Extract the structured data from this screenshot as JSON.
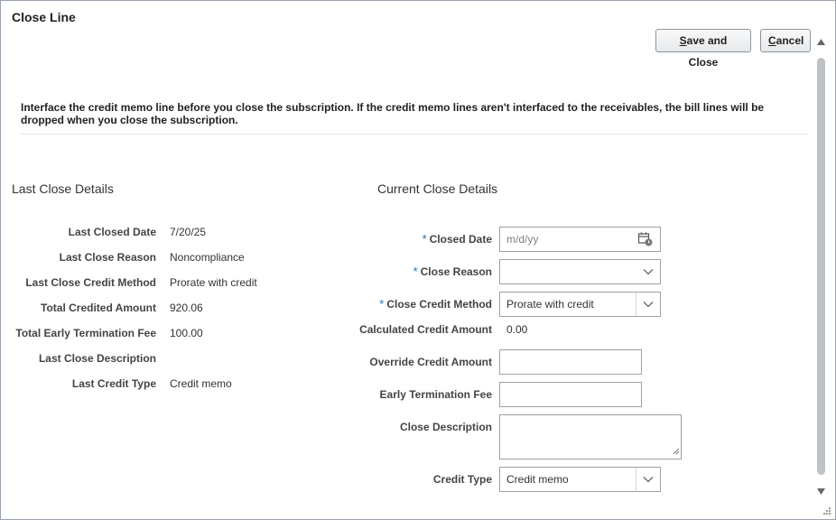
{
  "dialog": {
    "title": "Close Line",
    "save_label_pre": "",
    "save_label_u": "S",
    "save_label_post": "ave and Close",
    "cancel_label_u": "C",
    "cancel_label_post": "ancel",
    "message": "Interface the credit memo line before you close the subscription. If the credit memo lines aren't interfaced to the receivables, the bill lines will be dropped when you close the subscription."
  },
  "last_close": {
    "heading": "Last Close Details",
    "rows": [
      {
        "label": "Last Closed Date",
        "value": "7/20/25"
      },
      {
        "label": "Last Close Reason",
        "value": "Noncompliance"
      },
      {
        "label": "Last Close Credit Method",
        "value": "Prorate with credit"
      },
      {
        "label": "Total Credited Amount",
        "value": "920.06"
      },
      {
        "label": "Total Early Termination Fee",
        "value": "100.00"
      },
      {
        "label": "Last Close Description",
        "value": ""
      },
      {
        "label": "Last Credit Type",
        "value": "Credit memo"
      }
    ]
  },
  "current_close": {
    "heading": "Current Close Details",
    "closed_date": {
      "label": "Closed Date",
      "placeholder": "m/d/yy",
      "value": ""
    },
    "close_reason": {
      "label": "Close Reason",
      "value": ""
    },
    "close_credit_method": {
      "label": "Close Credit Method",
      "value": "Prorate with credit"
    },
    "calculated_credit_amount": {
      "label": "Calculated Credit Amount",
      "value": "0.00"
    },
    "override_credit_amount": {
      "label": "Override Credit Amount",
      "value": ""
    },
    "early_termination_fee": {
      "label": "Early Termination Fee",
      "value": ""
    },
    "close_description": {
      "label": "Close Description",
      "value": ""
    },
    "credit_type": {
      "label": "Credit Type",
      "value": "Credit memo"
    },
    "required_marker": "*"
  },
  "icons": {
    "calendar": "calendar-icon",
    "chevron": "chevron-down-icon",
    "scroll_up": "scroll-up-arrow-icon",
    "scroll_down": "scroll-down-arrow-icon"
  }
}
